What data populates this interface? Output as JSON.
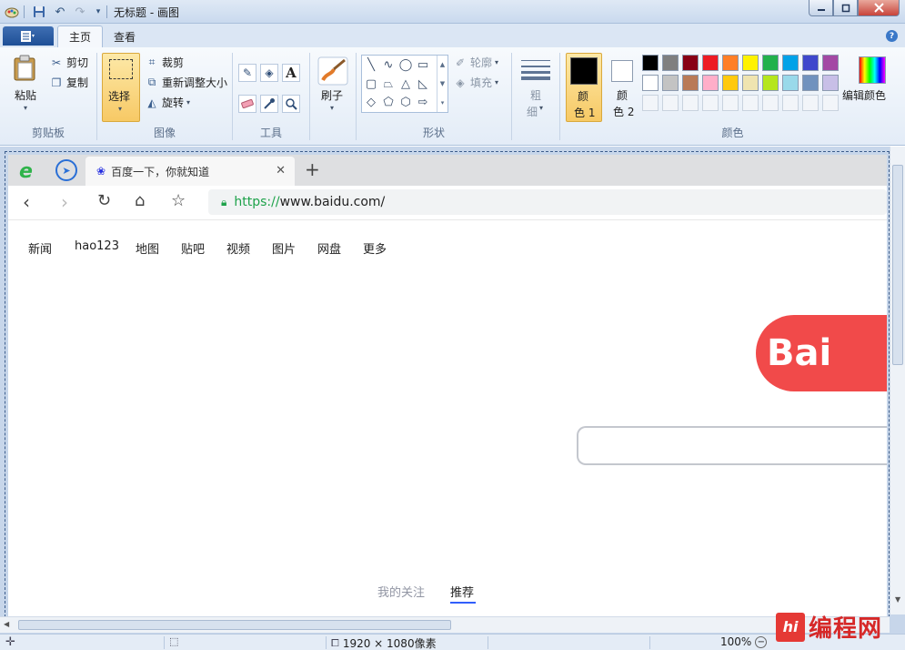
{
  "window": {
    "title": "无标题 - 画图"
  },
  "ribbon_tabs": {
    "file_icon": "menu-icon",
    "home": "主页",
    "view": "查看"
  },
  "clipboard": {
    "paste": "粘贴",
    "cut": "剪切",
    "copy": "复制",
    "label": "剪贴板"
  },
  "image_group": {
    "select": "选择",
    "crop": "裁剪",
    "resize": "重新调整大小",
    "rotate": "旋转",
    "label": "图像"
  },
  "tools_group": {
    "label": "工具",
    "text_tool": "A"
  },
  "brush": {
    "label": "刷子"
  },
  "shapes_group": {
    "outline": "轮廓",
    "fill": "填充",
    "label": "形状"
  },
  "size": {
    "label_top": "粗",
    "label_bottom": "细"
  },
  "colors_group": {
    "color1_top": "颜",
    "color1_bottom": "色 1",
    "color2_top": "颜",
    "color2_bottom": "色 2",
    "edit": "编辑颜色",
    "label": "颜色",
    "color1": "#000000",
    "color2": "#ffffff",
    "palette_row1": [
      "#000000",
      "#7f7f7f",
      "#880015",
      "#ed1c24",
      "#ff7f27",
      "#fff200",
      "#22b14c",
      "#00a2e8",
      "#3f48cc",
      "#a349a4"
    ],
    "palette_row2": [
      "#ffffff",
      "#c3c3c3",
      "#b97a57",
      "#ffaec9",
      "#ffc90e",
      "#efe4b0",
      "#b5e61d",
      "#99d9ea",
      "#7092be",
      "#c8bfe7"
    ]
  },
  "browser": {
    "tab_title": "百度一下，你就知道",
    "url_scheme": "https://",
    "url_host": "www.baidu.com/",
    "nav_links": [
      "新闻",
      "hao123",
      "地图",
      "贴吧",
      "视频",
      "图片",
      "网盘",
      "更多"
    ],
    "logo_text": "Bai",
    "feed_tabs": [
      "我的关注",
      "推荐"
    ]
  },
  "status_bar": {
    "dimensions": "1920 × 1080像素",
    "zoom": "100%"
  },
  "watermark": {
    "badge": "hi",
    "text": "编程网"
  }
}
